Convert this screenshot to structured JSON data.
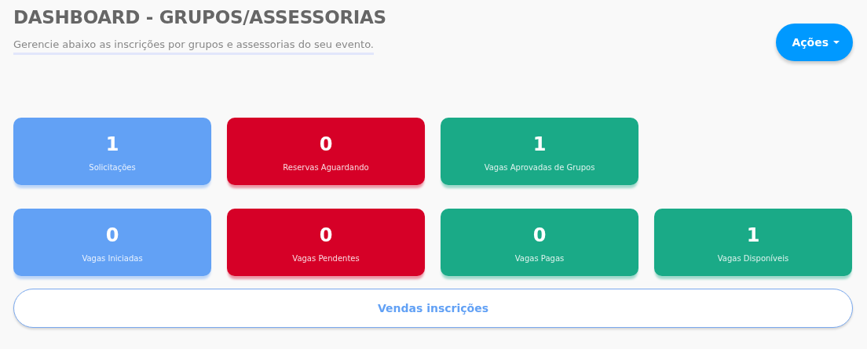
{
  "header": {
    "title": "DASHBOARD - GRUPOS/ASSESSORIAS",
    "subtitle": "Gerencie abaixo as inscrições por grupos e assessorias do seu evento.",
    "actions_button": "Ações"
  },
  "card_rows": [
    [
      {
        "value": "1",
        "label": "Solicitações",
        "color": "#62a1f5"
      },
      {
        "value": "0",
        "label": "Reservas Aguardando",
        "color": "#d60027"
      },
      {
        "value": "1",
        "label": "Vagas Aprovadas de Grupos",
        "color": "#1aaa87"
      }
    ],
    [
      {
        "value": "0",
        "label": "Vagas Iniciadas",
        "color": "#62a1f5"
      },
      {
        "value": "0",
        "label": "Vagas Pendentes",
        "color": "#d60027"
      },
      {
        "value": "0",
        "label": "Vagas Pagas",
        "color": "#1aaa87"
      },
      {
        "value": "1",
        "label": "Vagas Disponíveis",
        "color": "#1aaa87"
      }
    ]
  ],
  "sales_button": "Vendas inscrições"
}
